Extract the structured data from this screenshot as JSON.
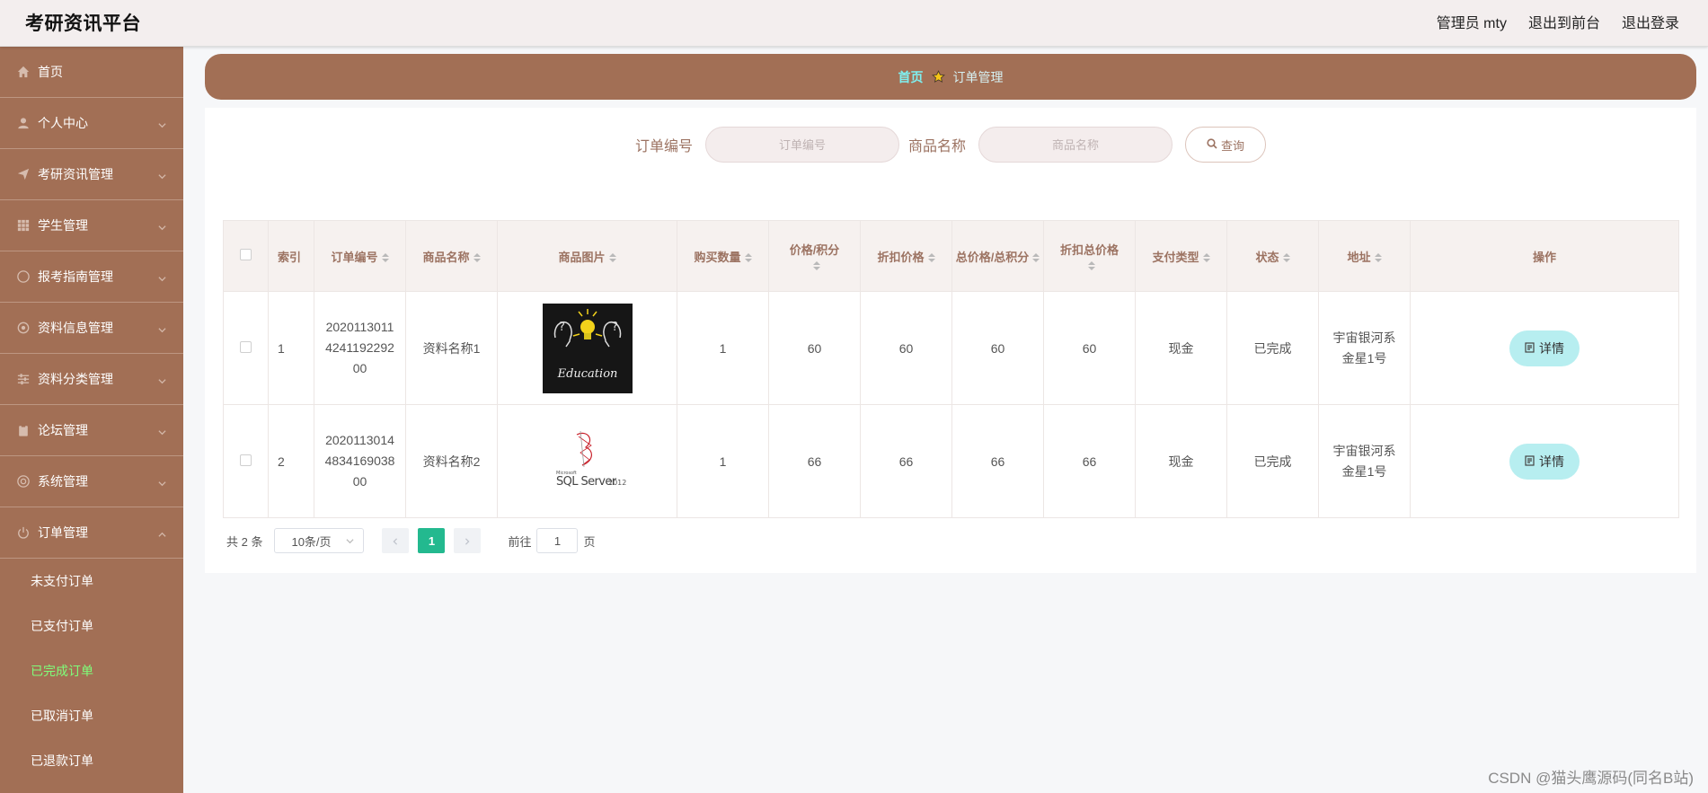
{
  "header": {
    "brand": "考研资讯平台",
    "user": "管理员 mty",
    "to_front": "退出到前台",
    "logout": "退出登录"
  },
  "sidebar": {
    "items": [
      {
        "label": "首页",
        "icon": "home-icon",
        "expandable": false
      },
      {
        "label": "个人中心",
        "icon": "user-icon",
        "expandable": true
      },
      {
        "label": "考研资讯管理",
        "icon": "send-icon",
        "expandable": true
      },
      {
        "label": "学生管理",
        "icon": "grid-icon",
        "expandable": true
      },
      {
        "label": "报考指南管理",
        "icon": "compass-icon",
        "expandable": true
      },
      {
        "label": "资料信息管理",
        "icon": "gear-icon",
        "expandable": true
      },
      {
        "label": "资料分类管理",
        "icon": "sliders-icon",
        "expandable": true
      },
      {
        "label": "论坛管理",
        "icon": "clipboard-icon",
        "expandable": true
      },
      {
        "label": "系统管理",
        "icon": "settings-icon",
        "expandable": true
      },
      {
        "label": "订单管理",
        "icon": "power-icon",
        "expandable": true,
        "expanded": true
      }
    ],
    "sub_items": [
      "未支付订单",
      "已支付订单",
      "已完成订单",
      "已取消订单",
      "已退款订单"
    ],
    "active_sub": "已完成订单"
  },
  "breadcrumb": {
    "home": "首页",
    "current": "订单管理"
  },
  "search": {
    "order_label": "订单编号",
    "order_placeholder": "订单编号",
    "goods_label": "商品名称",
    "goods_placeholder": "商品名称",
    "query_button": "查询"
  },
  "table": {
    "columns": [
      "索引",
      "订单编号",
      "商品名称",
      "商品图片",
      "购买数量",
      "价格/积分",
      "折扣价格",
      "总价格/总积分",
      "折扣总价格",
      "支付类型",
      "状态",
      "地址",
      "操作"
    ],
    "rows": [
      {
        "index": "1",
        "order_no": "2020113011424119229200",
        "goods": "资料名称1",
        "image": "education-image",
        "qty": "1",
        "price": "60",
        "discount": "60",
        "total": "60",
        "discount_total": "60",
        "pay_type": "现金",
        "status": "已完成",
        "address": "宇宙银河系金星1号",
        "action": "详情"
      },
      {
        "index": "2",
        "order_no": "2020113014483416903800",
        "goods": "资料名称2",
        "image": "sql-server-image",
        "qty": "1",
        "price": "66",
        "discount": "66",
        "total": "66",
        "discount_total": "66",
        "pay_type": "现金",
        "status": "已完成",
        "address": "宇宙银河系金星1号",
        "action": "详情"
      }
    ]
  },
  "pagination": {
    "total": "共 2 条",
    "page_size": "10条/页",
    "current_page": "1",
    "goto_label": "前往",
    "goto_value": "1",
    "page_suffix": "页"
  },
  "images": {
    "education_text": "Education",
    "sql_brand": "Microsoft",
    "sql_text": "SQL Server",
    "sql_year": "2012"
  },
  "watermark": "CSDN @猫头鹰源码(同名B站)",
  "colors": {
    "sidebar": "#a26f55",
    "accent_green": "#23b98f",
    "active_sub": "#7fff7a",
    "detail_button": "#b7eef0"
  }
}
